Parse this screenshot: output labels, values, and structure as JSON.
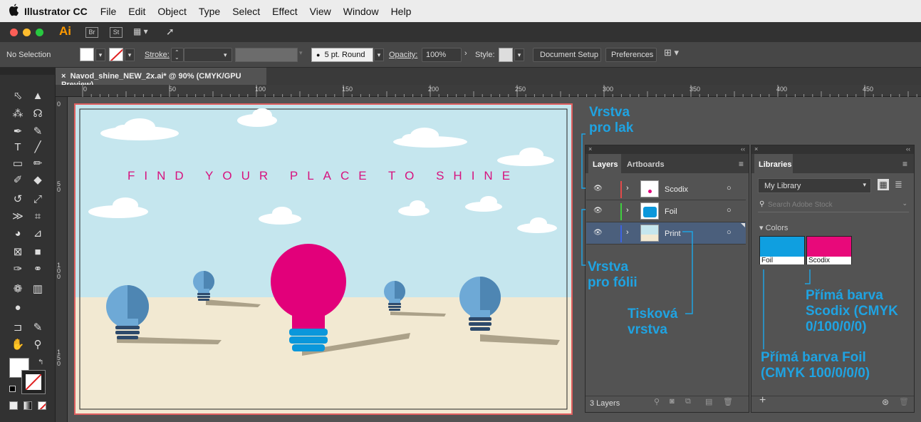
{
  "menubar": {
    "app": "Illustrator CC",
    "items": [
      "File",
      "Edit",
      "Object",
      "Type",
      "Select",
      "Effect",
      "View",
      "Window",
      "Help"
    ]
  },
  "appbar": {
    "logo": "Ai",
    "br": "Br",
    "st": "St"
  },
  "control": {
    "selection": "No Selection",
    "stroke_label": "Stroke:",
    "brush": "5 pt. Round",
    "opacity_label": "Opacity:",
    "opacity_value": "100%",
    "style_label": "Style:",
    "doc_setup": "Document Setup",
    "preferences": "Preferences"
  },
  "document": {
    "tab_title": "Navod_shine_NEW_2x.ai* @ 90% (CMYK/GPU Preview)"
  },
  "ruler": {
    "h": [
      "0",
      "50",
      "100",
      "150",
      "200",
      "250",
      "300",
      "350",
      "400",
      "450"
    ],
    "v": [
      "0",
      "5\n0",
      "1\n0\n0",
      "1\n5\n0"
    ]
  },
  "artwork": {
    "headline": "FIND YOUR PLACE TO SHINE"
  },
  "layers_panel": {
    "tabs": [
      "Layers",
      "Artboards"
    ],
    "layers": [
      {
        "name": "Scodix",
        "color": "#e24a4a"
      },
      {
        "name": "Foil",
        "color": "#3fcf3f"
      },
      {
        "name": "Print",
        "color": "#3d63e0"
      }
    ],
    "count": "3 Layers"
  },
  "libraries_panel": {
    "title": "Libraries",
    "library": "My Library",
    "search_placeholder": "Search Adobe Stock",
    "section": "Colors",
    "swatches": [
      {
        "name": "Foil",
        "color": "#0f9fe0"
      },
      {
        "name": "Scodix",
        "color": "#e8097a"
      }
    ]
  },
  "annotations": {
    "lak": "Vrstva\npro lak",
    "folii": "Vrstva\npro fólii",
    "tiskova": "Tisková\nvrstva",
    "scodix": "Přímá barva\nScodix (CMYK\n0/100/0/0)",
    "foil": "Přímá barva Foil\n(CMYK 100/0/0/0)"
  },
  "colors": {
    "annotation": "#1fa3e2",
    "sky": "#c5e6ee",
    "ground": "#f2e9d2",
    "magenta": "#e2007a",
    "cyan": "#0a97db",
    "bulb_blue": "#6ea9d6"
  }
}
